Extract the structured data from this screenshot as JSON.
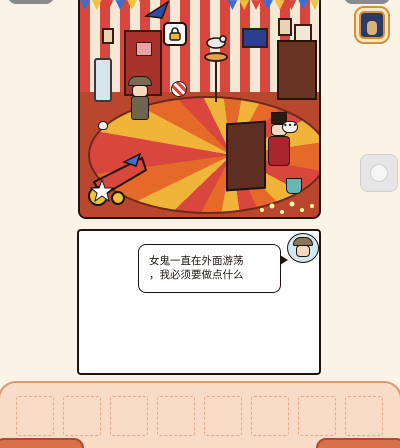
{
  "scene": {
    "name": "circus-room",
    "lock_icon": "padlock-icon",
    "npc_bubble_icon": "ellipsis-icon"
  },
  "buttons": {
    "inventory_icon": "framed-portrait-icon",
    "side_icon": "circle-icon"
  },
  "dialog": {
    "speaker_icon": "detective-avatar-icon",
    "line1": "女鬼一直在外面游荡",
    "line2": "，我必须要做点什么"
  },
  "inventory": {
    "slot_count": 8,
    "slots": [
      "",
      "",
      "",
      "",
      "",
      "",
      "",
      ""
    ]
  },
  "colors": {
    "background": "#fbf3e6",
    "tray": "#f8dcc8",
    "tray_border": "#d89a72",
    "accent_orange": "#d59035"
  }
}
